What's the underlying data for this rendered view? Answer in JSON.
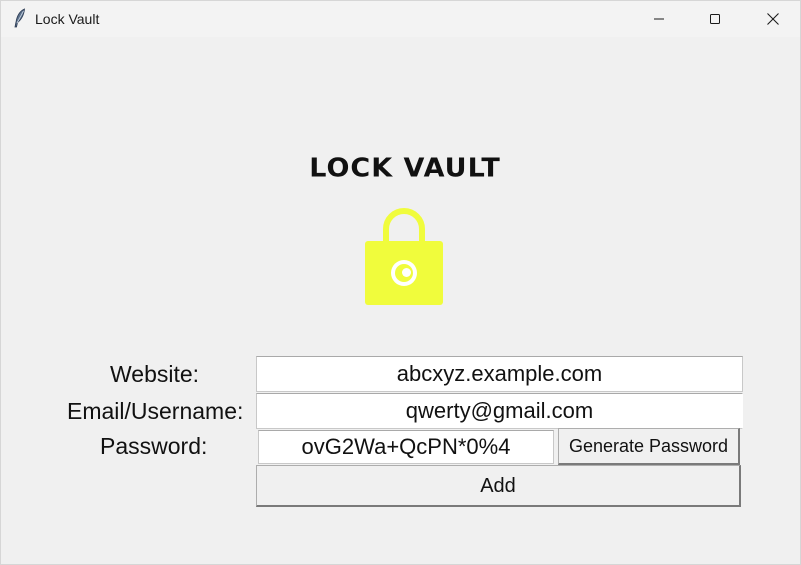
{
  "window": {
    "title": "Lock Vault",
    "app_icon": "feather-icon",
    "controls": [
      "minimize-icon",
      "maximize-icon",
      "close-icon"
    ]
  },
  "logo": {
    "title": "LOCK VAULT",
    "icon": "padlock-icon",
    "icon_color": "#f0fc3c"
  },
  "form": {
    "website_label": "Website:",
    "website_value": "abcxyz.example.com",
    "email_label": "Email/Username:",
    "email_value": "qwerty@gmail.com",
    "password_label": "Password:",
    "password_value": "ovG2Wa+QcPN*0%4",
    "generate_button": "Generate Password",
    "add_button": "Add"
  }
}
